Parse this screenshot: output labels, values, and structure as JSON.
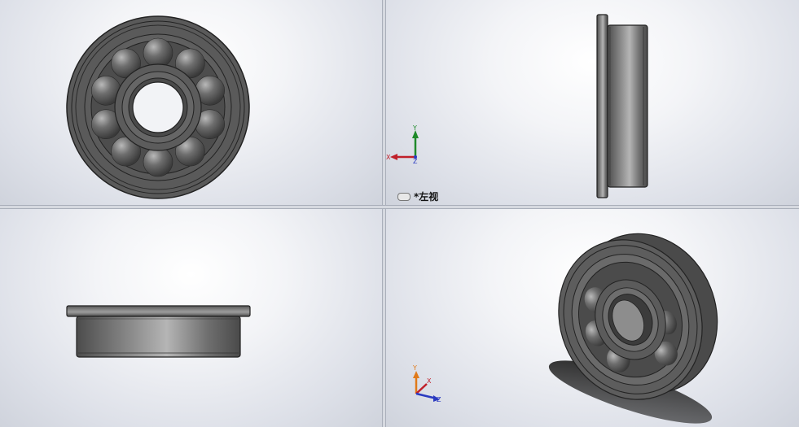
{
  "viewports": {
    "top_left": {
      "name": "front-view"
    },
    "top_right": {
      "name": "left-view",
      "label": "*左视"
    },
    "bottom_left": {
      "name": "top-view"
    },
    "bottom_right": {
      "name": "isometric-view"
    }
  },
  "triads": {
    "top_right": {
      "y": "Y",
      "x": "X",
      "z": "Z"
    },
    "bottom_right": {
      "y": "Y",
      "x": "X",
      "z": "Z"
    }
  },
  "colors": {
    "part_dark": "#3e3e3e",
    "part_mid": "#6b6b6b",
    "part_light": "#9a9a9a",
    "axis_x": "#c0202a",
    "axis_y": "#1f8a2a",
    "axis_z": "#2a3ac0"
  },
  "icons": {
    "view_tag": "view-orientation-icon"
  }
}
